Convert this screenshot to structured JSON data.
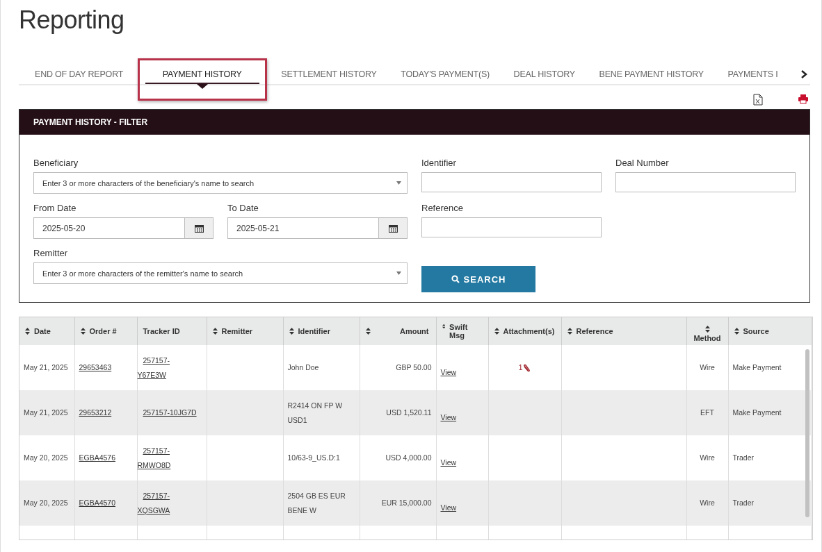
{
  "page_title": "Reporting",
  "tabs": [
    {
      "label": "END OF DAY REPORT",
      "selected": false
    },
    {
      "label": "PAYMENT HISTORY",
      "selected": true
    },
    {
      "label": "SETTLEMENT HISTORY",
      "selected": false
    },
    {
      "label": "TODAY'S PAYMENT(S)",
      "selected": false
    },
    {
      "label": "DEAL HISTORY",
      "selected": false
    },
    {
      "label": "BENE PAYMENT HISTORY",
      "selected": false
    },
    {
      "label": "PAYMENTS I",
      "selected": false
    }
  ],
  "filter": {
    "title": "PAYMENT HISTORY - FILTER",
    "beneficiary": {
      "label": "Beneficiary",
      "placeholder": "Enter 3 or more characters of the beneficiary's name to search"
    },
    "identifier": {
      "label": "Identifier"
    },
    "deal_number": {
      "label": "Deal Number"
    },
    "from_date": {
      "label": "From Date",
      "value": "2025-05-20"
    },
    "to_date": {
      "label": "To Date",
      "value": "2025-05-21"
    },
    "reference": {
      "label": "Reference"
    },
    "remitter": {
      "label": "Remitter",
      "placeholder": "Enter 3 or more characters of the remitter's name to search"
    },
    "search_button": "SEARCH"
  },
  "table": {
    "columns": [
      {
        "label": "Date",
        "sortable": true
      },
      {
        "label": "Order #",
        "sortable": true
      },
      {
        "label": "Tracker ID",
        "sortable": false
      },
      {
        "label": "Remitter",
        "sortable": true
      },
      {
        "label": "Identifier",
        "sortable": true
      },
      {
        "label": "Amount",
        "sortable": true
      },
      {
        "label": "Swift Msg",
        "sortable": true
      },
      {
        "label": "Attachment(s)",
        "sortable": true
      },
      {
        "label": "Reference",
        "sortable": true
      },
      {
        "label": "Method",
        "sortable": true
      },
      {
        "label": "Source",
        "sortable": true
      }
    ],
    "rows": [
      {
        "date": "May 21, 2025",
        "order": "29653463",
        "tracker_id": [
          "257157-",
          "Y67E3W"
        ],
        "identifier": [
          "John Doe"
        ],
        "amount": "GBP 50.00",
        "swift": "View",
        "attachments": "1",
        "method": "Wire",
        "source": "Make Payment"
      },
      {
        "date": "May 21, 2025",
        "order": "29653212",
        "tracker_id": [
          "257157-10JG7D"
        ],
        "identifier": [
          "R2414 ON FP W",
          "USD1"
        ],
        "amount": "USD 1,520.11",
        "swift": "View",
        "method": "EFT",
        "source": "Make Payment"
      },
      {
        "date": "May 20, 2025",
        "order": "EGBA4576",
        "tracker_id": [
          "257157-",
          "RMWO8D"
        ],
        "identifier": [
          "10/63-9_US.D:1"
        ],
        "amount": "USD 4,000.00",
        "swift": "View",
        "method": "Wire",
        "source": "Trader"
      },
      {
        "date": "May 20, 2025",
        "order": "EGBA4570",
        "tracker_id": [
          "257157-",
          "XQSGWA"
        ],
        "identifier": [
          "2504 GB ES EUR",
          "BENE W"
        ],
        "amount": "EUR 15,000.00",
        "swift": "View",
        "method": "Wire",
        "source": "Trader"
      }
    ]
  }
}
